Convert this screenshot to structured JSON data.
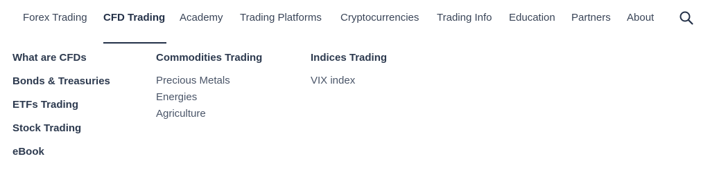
{
  "nav": {
    "items": [
      {
        "label": "Forex Trading"
      },
      {
        "label": "CFD Trading"
      },
      {
        "label": "Academy"
      },
      {
        "label": "Trading Platforms"
      },
      {
        "label": "Cryptocurrencies"
      },
      {
        "label": "Trading Info"
      },
      {
        "label": "Education"
      },
      {
        "label": "Partners"
      },
      {
        "label": "About"
      }
    ],
    "active": "CFD Trading",
    "search_icon": "search-icon"
  },
  "dropdown": {
    "col1": [
      {
        "label": "What are CFDs"
      },
      {
        "label": "Bonds & Treasuries"
      },
      {
        "label": "ETFs Trading"
      },
      {
        "label": "Stock Trading"
      },
      {
        "label": "eBook"
      }
    ],
    "col2": {
      "heading": "Commodities Trading",
      "links": [
        {
          "label": "Precious Metals"
        },
        {
          "label": "Energies"
        },
        {
          "label": "Agriculture"
        }
      ]
    },
    "col3": {
      "heading": "Indices Trading",
      "links": [
        {
          "label": "VIX index"
        }
      ]
    }
  },
  "colors": {
    "text_dark": "#243148",
    "text_nav": "#3a4558",
    "text_link": "#4a5568"
  }
}
